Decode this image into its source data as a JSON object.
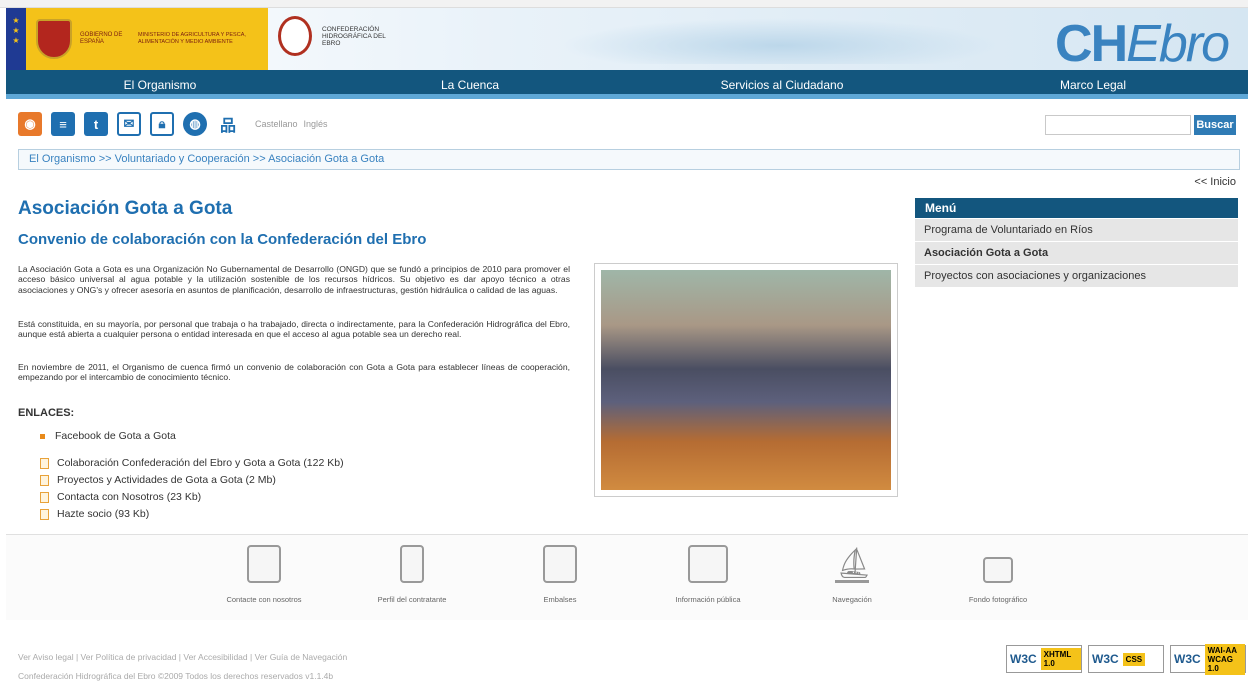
{
  "header": {
    "gov_text": "GOBIERNO DE ESPAÑA",
    "ministry_text": "MINISTERIO DE AGRICULTURA Y PESCA, ALIMENTACIÓN Y MEDIO AMBIENTE",
    "che_text": "CONFEDERACIÓN HIDROGRÁFICA DEL EBRO",
    "brand_prefix": "CH",
    "brand_suffix": "Ebro"
  },
  "nav": {
    "items": [
      "El Organismo",
      "La Cuenca",
      "Servicios al Ciudadano",
      "Marco Legal"
    ]
  },
  "toolbar": {
    "icons": [
      "rss-icon",
      "news-icon",
      "twitter-icon",
      "mail-icon",
      "lock-icon",
      "globe-icon",
      "sitemap-icon"
    ],
    "lang_es": "Castellano",
    "lang_en": "Inglés"
  },
  "search": {
    "value": "",
    "button": "Buscar"
  },
  "breadcrumb": "El Organismo >> Voluntariado y Cooperación >> Asociación Gota a Gota",
  "inicio": "<< Inicio",
  "content": {
    "title": "Asociación Gota a Gota",
    "subtitle": "Convenio de colaboración con la Confederación del Ebro",
    "p1": "La Asociación Gota a Gota es una Organización No Gubernamental de Desarrollo (ONGD) que se fundó a principios de 2010 para promover el acceso básico universal al agua potable y la utilización sostenible de los recursos hídricos. Su objetivo es dar apoyo técnico a otras asociaciones y ONG's y ofrecer asesoría en asuntos de planificación, desarrollo de infraestructuras, gestión hidráulica o calidad de las aguas.",
    "p2": "Está constituida, en su mayoría, por personal que trabaja o ha trabajado, directa o indirectamente, para la Confederación Hidrográfica del Ebro, aunque está abierta a cualquier persona o entidad interesada en que el acceso al agua potable sea un derecho real.",
    "p3": "En noviembre de 2011, el Organismo de cuenca firmó un convenio de colaboración con Gota a Gota para establecer líneas de cooperación, empezando por el intercambio de conocimiento técnico.",
    "links_heading": "ENLACES:",
    "link_facebook": "Facebook de Gota a Gota",
    "docs": [
      "Colaboración Confederación del Ebro y Gota a Gota (122 Kb)",
      "Proyectos y Actividades de Gota a Gota (2 Mb)",
      "Contacta con Nosotros (23 Kb)",
      "Hazte socio (93 Kb)"
    ]
  },
  "menu": {
    "title": "Menú",
    "items": [
      "Programa de Voluntariado en Ríos",
      "Asociación Gota a Gota",
      "Proyectos con asociaciones y organizaciones"
    ]
  },
  "footer": {
    "items": [
      {
        "label": "Contacte con nosotros",
        "icon": "contact-icon"
      },
      {
        "label": "Perfil del contratante",
        "icon": "profile-icon"
      },
      {
        "label": "Embalses",
        "icon": "dam-icon"
      },
      {
        "label": "Información pública",
        "icon": "book-icon"
      },
      {
        "label": "Navegación",
        "icon": "sailboat-icon"
      },
      {
        "label": "Fondo fotográfico",
        "icon": "camera-icon"
      }
    ],
    "legal": "Ver Aviso legal | Ver Política de privacidad | Ver Accesibilidad | Ver Guía de Navegación",
    "copyright": "Confederación Hidrográfica del Ebro ©2009 Todos los derechos reservados v1.1.4b",
    "badges": [
      {
        "w3c": "W3C",
        "label": "XHTML 1.0"
      },
      {
        "w3c": "W3C",
        "label": "CSS"
      },
      {
        "w3c": "W3C",
        "label": "WAI-AA WCAG 1.0"
      }
    ]
  }
}
